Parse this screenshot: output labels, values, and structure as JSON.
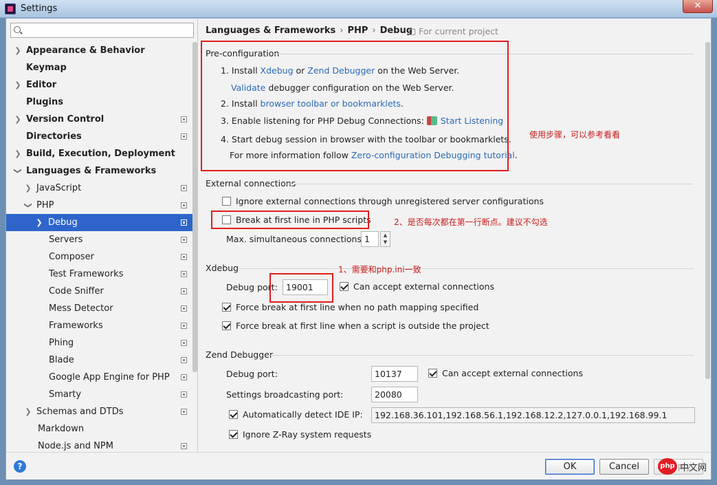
{
  "window": {
    "title": "Settings",
    "close_glyph": "✕"
  },
  "search": {
    "placeholder": ""
  },
  "sidebar": {
    "items": [
      {
        "label": "Appearance & Behavior"
      },
      {
        "label": "Keymap"
      },
      {
        "label": "Editor"
      },
      {
        "label": "Plugins"
      },
      {
        "label": "Version Control"
      },
      {
        "label": "Directories"
      },
      {
        "label": "Build, Execution, Deployment"
      },
      {
        "label": "Languages & Frameworks"
      },
      {
        "label": "JavaScript"
      },
      {
        "label": "PHP"
      },
      {
        "label": "Debug"
      },
      {
        "label": "Servers"
      },
      {
        "label": "Composer"
      },
      {
        "label": "Test Frameworks"
      },
      {
        "label": "Code Sniffer"
      },
      {
        "label": "Mess Detector"
      },
      {
        "label": "Frameworks"
      },
      {
        "label": "Phing"
      },
      {
        "label": "Blade"
      },
      {
        "label": "Google App Engine for PHP"
      },
      {
        "label": "Smarty"
      },
      {
        "label": "Schemas and DTDs"
      },
      {
        "label": "Markdown"
      },
      {
        "label": "Node.js and NPM"
      }
    ]
  },
  "header": {
    "crumbs": [
      "Languages & Frameworks",
      "PHP",
      "Debug"
    ],
    "for_project": "For current project"
  },
  "preconfig": {
    "title": "Pre-configuration",
    "step1": {
      "num": "1.",
      "text_a": "Install",
      "link_a": "Xdebug",
      "text_b": "or",
      "link_b": "Zend Debugger",
      "text_c": "on the Web Server."
    },
    "step1b": {
      "link": "Validate",
      "text": "debugger configuration on the Web Server."
    },
    "step2": {
      "num": "2.",
      "text_a": "Install",
      "link": "browser toolbar or bookmarklets",
      "text_b": "."
    },
    "step3": {
      "num": "3.",
      "text": "Enable listening for PHP Debug Connections:",
      "link": "Start Listening"
    },
    "step4": {
      "num": "4.",
      "text": "Start debug session in browser with the toolbar or bookmarklets."
    },
    "step4b": {
      "text": "For more information follow",
      "link": "Zero-configuration Debugging tutorial",
      "end": "."
    }
  },
  "external": {
    "title": "External connections",
    "ignore_label": "Ignore external connections through unregistered server configurations",
    "ignore_checked": false,
    "break_label": "Break at first line in PHP scripts",
    "break_checked": false,
    "max_label": "Max. simultaneous connections:",
    "max_value": "1"
  },
  "xdebug": {
    "title": "Xdebug",
    "port_label": "Debug port:",
    "port_value": "19001",
    "accept_label": "Can accept external connections",
    "accept_checked": true,
    "force_nomap_label": "Force break at first line when no path mapping specified",
    "force_nomap_checked": true,
    "force_outside_label": "Force break at first line when a script is outside the project",
    "force_outside_checked": true
  },
  "zend": {
    "title": "Zend Debugger",
    "port_label": "Debug port:",
    "port_value": "10137",
    "accept_label": "Can accept external connections",
    "accept_checked": true,
    "broadcast_label": "Settings broadcasting port:",
    "broadcast_value": "20080",
    "detect_label": "Automatically detect IDE IP:",
    "detect_checked": true,
    "ip_value": "192.168.36.101,192.168.56.1,192.168.12.2,127.0.0.1,192.168.99.1",
    "zray_label": "Ignore Z-Ray system requests",
    "zray_checked": true
  },
  "annotations": {
    "preconfig_note": "使用步骤，可以参考看看",
    "break_note": "2、是否每次都在第一行断点。建议不勾选",
    "port_note": "1、需要和php.ini一致",
    "accent_color": "#e01e1e"
  },
  "buttons": {
    "help": "?",
    "ok": "OK",
    "cancel": "Cancel",
    "apply": "Apply"
  },
  "watermark": {
    "logo": "php",
    "text": "中文网"
  }
}
